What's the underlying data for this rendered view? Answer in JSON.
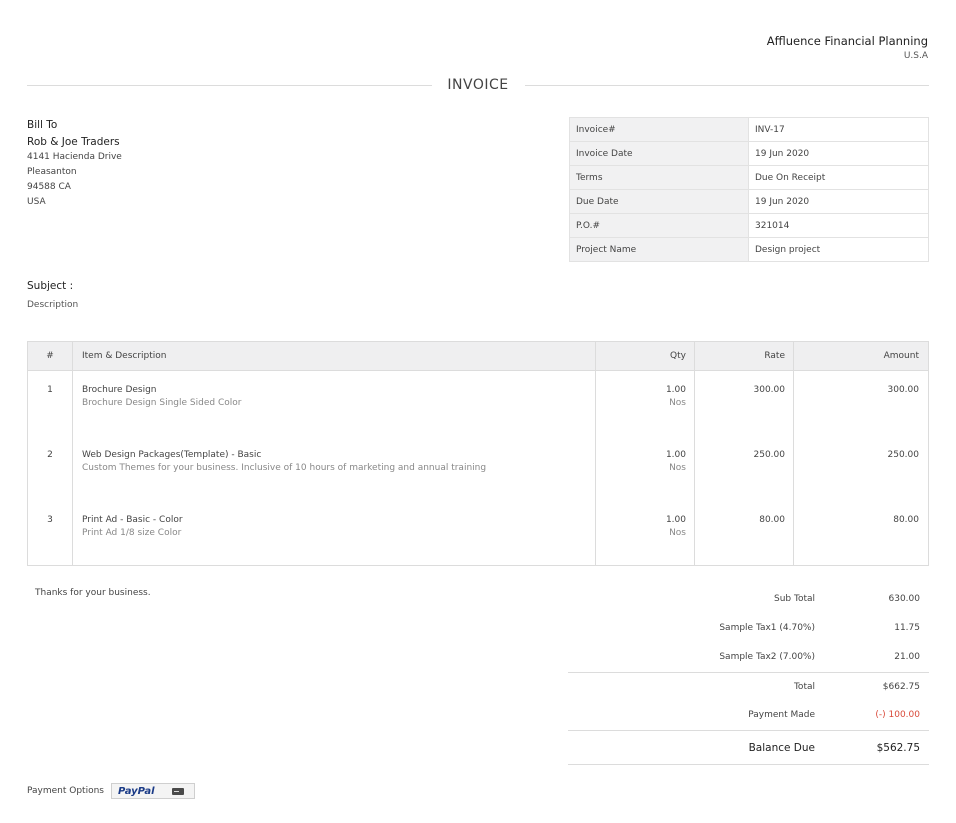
{
  "organization": {
    "name": "Affluence Financial Planning",
    "country": "U.S.A"
  },
  "title": "INVOICE",
  "bill_to": {
    "label": "Bill To",
    "name": "Rob & Joe Traders",
    "address": [
      "4141 Hacienda Drive",
      "Pleasanton",
      "94588 CA",
      "USA"
    ]
  },
  "meta": [
    {
      "label": "Invoice#",
      "value": "INV-17"
    },
    {
      "label": "Invoice Date",
      "value": "19 Jun 2020"
    },
    {
      "label": "Terms",
      "value": "Due On Receipt"
    },
    {
      "label": "Due Date",
      "value": "19 Jun 2020"
    },
    {
      "label": "P.O.#",
      "value": "321014"
    },
    {
      "label": "Project Name",
      "value": "Design project"
    }
  ],
  "subject": {
    "label": "Subject :",
    "description": "Description"
  },
  "items_table": {
    "headers": {
      "num": "#",
      "item": "Item & Description",
      "qty": "Qty",
      "rate": "Rate",
      "amount": "Amount"
    },
    "rows": [
      {
        "num": "1",
        "name": "Brochure Design",
        "desc": "Brochure Design Single Sided Color",
        "qty": "1.00",
        "unit": "Nos",
        "rate": "300.00",
        "amount": "300.00"
      },
      {
        "num": "2",
        "name": "Web Design Packages(Template) - Basic",
        "desc": "Custom Themes for your business. Inclusive of 10 hours of marketing and annual training",
        "qty": "1.00",
        "unit": "Nos",
        "rate": "250.00",
        "amount": "250.00"
      },
      {
        "num": "3",
        "name": "Print Ad - Basic - Color",
        "desc": "Print Ad 1/8 size Color",
        "qty": "1.00",
        "unit": "Nos",
        "rate": "80.00",
        "amount": "80.00"
      }
    ]
  },
  "notes": "Thanks for your business.",
  "totals": {
    "subtotal_label": "Sub Total",
    "subtotal": "630.00",
    "tax1_label": "Sample Tax1 (4.70%)",
    "tax1": "11.75",
    "tax2_label": "Sample Tax2 (7.00%)",
    "tax2": "21.00",
    "total_label": "Total",
    "total": "$662.75",
    "payment_label": "Payment Made",
    "payment": "(-) 100.00",
    "balance_label": "Balance Due",
    "balance": "$562.75"
  },
  "payment_options": {
    "label": "Payment Options",
    "paypal": "PayPal",
    "card_icon": "credit-card-icon"
  },
  "colors": {
    "negative": "#d94a3a",
    "header_bg": "#efeff0",
    "paypal": "#1b3b87"
  }
}
